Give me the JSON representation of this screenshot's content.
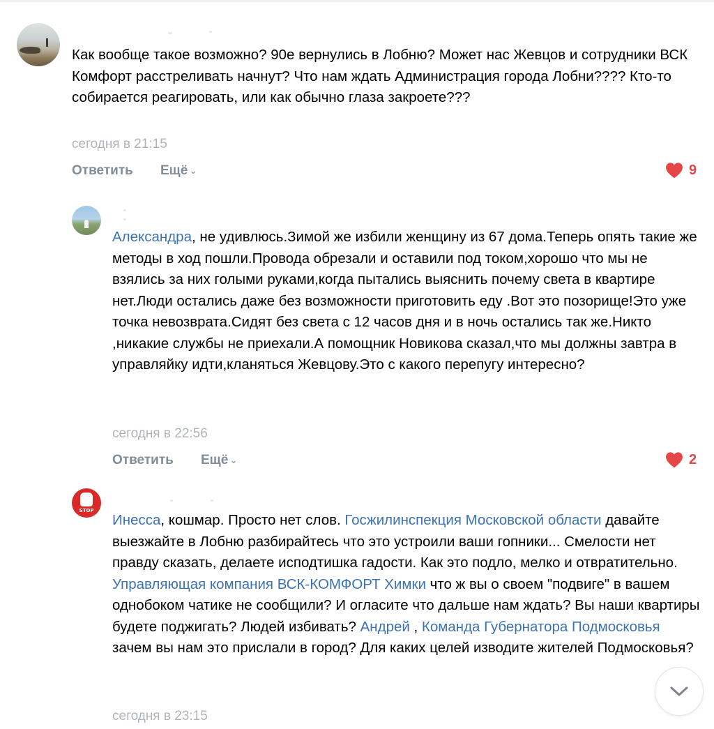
{
  "comments": [
    {
      "text": "Как вообще такое возможно? 90е вернулись в Лобню? Может нас Жевцов и сотрудники ВСК Комфорт расстреливать начнут? Что нам ждать Администрация города Лобни???? Кто-то собирается реагировать, или как обычно глаза закроете???",
      "time": "сегодня в 21:15",
      "reply_label": "Ответить",
      "more_label": "Ещё",
      "likes": "9"
    },
    {
      "mention": "Александра",
      "text": ", не удивлюсь.Зимой же избили женщину из 67 дома.Теперь опять такие же методы в ход пошли.Провода обрезали и оставили под током,хорошо что мы не взялись за них голыми руками,когда пытались выяснить почему света в квартире нет.Люди остались даже без возможности приготовить еду .Вот это позорище!Это уже точка невозврата.Сидят без света с 12 часов дня и в ночь остались так же.Никто ,никакие службы не приехали.А помощник Новикова сказал,что мы должны завтра в управляйку идти,кланяться Жевцову.Это с какого перепугу интересно?",
      "time": "сегодня в 22:56",
      "reply_label": "Ответить",
      "more_label": "Ещё",
      "likes": "2"
    },
    {
      "mention1": "Инесса",
      "text1": ", кошмар. Просто нет слов. ",
      "mention2": "Госжилинспекция Московской области",
      "text2": " давайте выезжайте в Лобню разбирайтесь что это устроили ваши гопники... Смелости нет правду сказать, делаете исподтишка гадости. Как это подло, мелко и отвратительно. ",
      "mention3": "Управляющая компания ВСК-КОМФОРТ Химки",
      "text3": " что ж вы о своем \"подвиге\" в вашем однобоком чатике не сообщили? И огласите что дальше нам ждать? Вы наши квартиры будете поджигать? Людей избивать? ",
      "mention4": "Андрей",
      "text4": " , ",
      "mention5": "Команда Губернатора Подмосковья",
      "text5": " зачем вы нам это прислали в город? Для каких целей изводите жителей Подмосковья?",
      "time": "сегодня в 23:15",
      "avatar_label": "STOP"
    }
  ],
  "colors": {
    "link": "#3d72b0",
    "muted": "#818c99",
    "time": "#aeb4bb",
    "like": "#e64646"
  },
  "icons": {
    "like": "heart-icon",
    "more": "chevron-down-icon",
    "scroll": "chevron-down-icon"
  }
}
